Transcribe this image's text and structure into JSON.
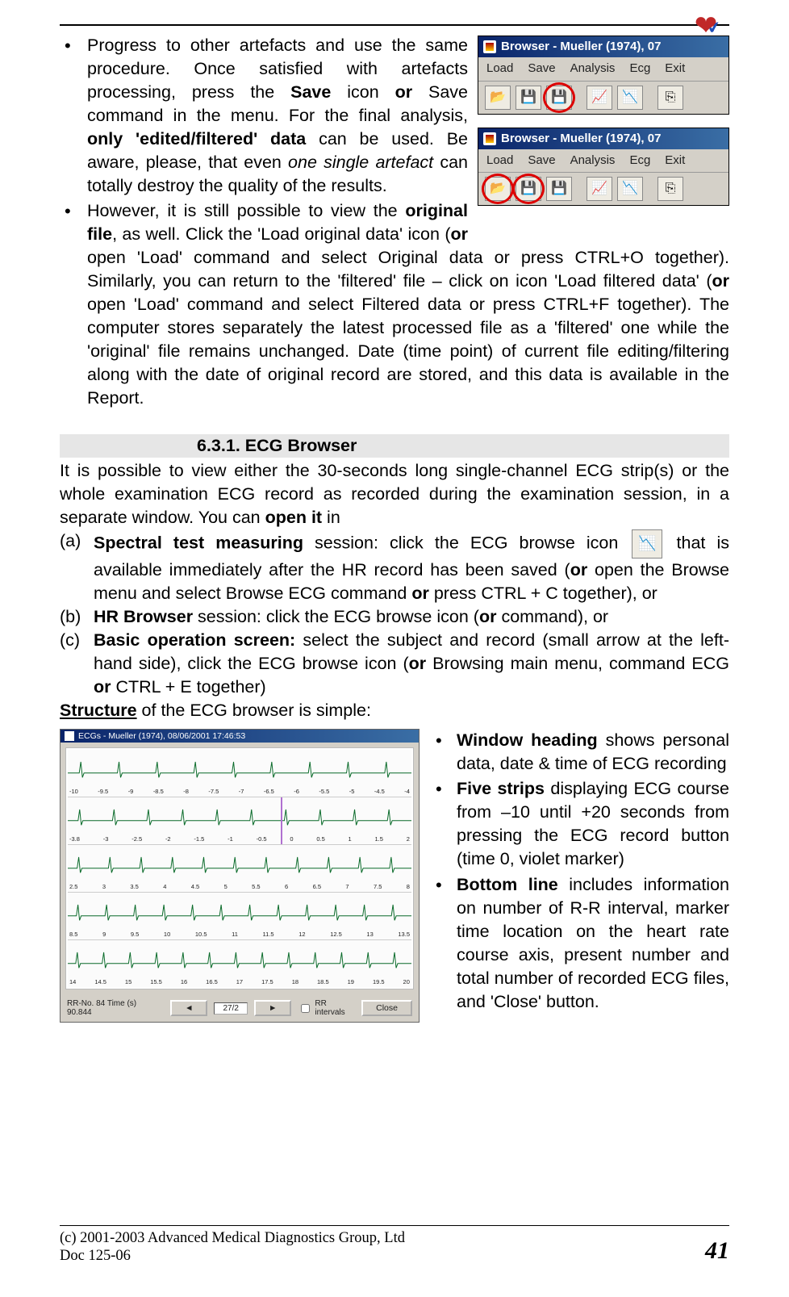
{
  "bullets": {
    "b1_pre": "Progress to other artefacts and use the same procedure. Once satisfied with artefacts processing, press the ",
    "b1_save": "Save",
    "b1_mid1": " icon ",
    "b1_or1": "or ",
    "b1_mid2": "Save command in the menu. For the final analysis, ",
    "b1_only": "only 'edited/filtered' data",
    "b1_mid3": " can be used. Be aware, please, that even ",
    "b1_ita": "one single artefact",
    "b1_end": " can totally destroy the quality of the results.",
    "b2_pre": "However, it is still possible to view the ",
    "b2_orig": "original file",
    "b2_mid1": ", as well. Click the 'Load original data' icon (",
    "b2_or1": "or",
    "b2_mid2": " open 'Load' command and select Original data or press CTRL+O together). Similarly, you can return to the 'filtered' file – click on icon 'Load filtered data' (",
    "b2_or2": "or",
    "b2_end": " open 'Load' command and select Filtered data or press CTRL+F together). The computer stores separately the latest processed file as a 'filtered' one while the 'original' file remains unchanged. Date (time point) of current file editing/filtering along with the date of original record are stored, and this data is available in the Report."
  },
  "win": {
    "title": "Browser - Mueller (1974), 07",
    "menu": [
      "Load",
      "Save",
      "Analysis",
      "Ecg",
      "Exit"
    ],
    "icons": [
      "📂",
      "💾",
      "💾",
      "📈",
      "📉",
      "⎘"
    ]
  },
  "section_heading": "6.3.1. ECG Browser",
  "p2": {
    "t1": "It is possible to view either the 30-seconds long single-channel ECG strip(s) or the whole examination ECG record as recorded during the examination session, in a separate window. You can ",
    "open": "open it",
    "t2": " in"
  },
  "abc": {
    "a_lab": "(a)",
    "a_b": "Spectral test measuring",
    "a_t1": " session: click the ECG browse icon ",
    "a_icon": "📉",
    "a_t2": " that is available immediately after the HR record has been saved (",
    "a_or": "or ",
    "a_t3": "open the Browse menu and select Browse ECG command ",
    "a_or2": "or ",
    "a_t4": "press CTRL + C together), or",
    "b_lab": "(b)",
    "b_b": "HR Browser",
    "b_t1": " session: click the ECG browse icon (",
    "b_or": "or ",
    "b_t2": "command), or",
    "c_lab": "(c)",
    "c_b": "Basic operation screen:",
    "c_t1": " select the subject and record (small arrow at the left-hand side), click the ECG browse icon (",
    "c_or": "or ",
    "c_t2": "Browsing main menu, command ECG ",
    "c_or2": "or ",
    "c_t3": "CTRL + E together)"
  },
  "structure_line": {
    "s": "Structure",
    "rest": " of the ECG browser is simple:"
  },
  "ecg": {
    "title": "ECGs - Mueller (1974), 08/06/2001 17:46:53",
    "strips": [
      {
        "ticks": [
          "-10",
          "-9.5",
          "-9",
          "-8.5",
          "-8",
          "-7.5",
          "-7",
          "-6.5",
          "-6",
          "-5.5",
          "-5",
          "-4.5",
          "-4"
        ]
      },
      {
        "ticks": [
          "-3.8",
          "-3",
          "-2.5",
          "-2",
          "-1.5",
          "-1",
          "-0.5",
          "0",
          "0.5",
          "1",
          "1.5",
          "2"
        ],
        "violet": 0.62
      },
      {
        "ticks": [
          "2.5",
          "3",
          "3.5",
          "4",
          "4.5",
          "5",
          "5.5",
          "6",
          "6.5",
          "7",
          "7.5",
          "8"
        ]
      },
      {
        "ticks": [
          "8.5",
          "9",
          "9.5",
          "10",
          "10.5",
          "11",
          "11.5",
          "12",
          "12.5",
          "13",
          "13.5"
        ]
      },
      {
        "ticks": [
          "14",
          "14.5",
          "15",
          "15.5",
          "16",
          "16.5",
          "17",
          "17.5",
          "18",
          "18.5",
          "19",
          "19.5",
          "20"
        ]
      }
    ],
    "bottom": {
      "rr": "RR-No.  84   Time (s) 90.844",
      "arrow_l": "◄",
      "val": "27/2",
      "arrow_r": "►",
      "chk": "RR intervals",
      "close": "Close"
    }
  },
  "right": {
    "i1_b": "Window heading",
    "i1_t": " shows personal data, date & time of ECG recording",
    "i2_b": "Five strips",
    "i2_t": " displaying ECG course from –10 until +20 seconds from pressing the ECG record button (time 0, violet marker)",
    "i3_b": "Bottom line",
    "i3_t": " includes information on number of R-R interval, marker time location on the heart rate course axis, present number and total number of recorded ECG files, and 'Close' button."
  },
  "footer": {
    "c": "(c) 2001-2003 Advanced Medical Diagnostics Group, Ltd",
    "doc": "Doc 125-06",
    "page": "41"
  }
}
